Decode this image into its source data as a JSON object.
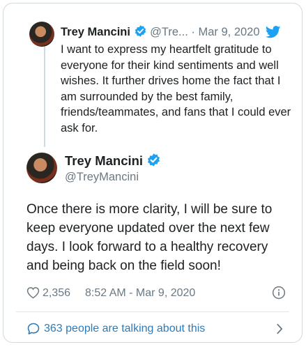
{
  "parent_tweet": {
    "author_name": "Trey Mancini",
    "handle": "@Tre...",
    "separator": "·",
    "date": "Mar 9, 2020",
    "text": "I want to express my heartfelt gratitude to everyone for their kind sentiments and well wishes. It further drives home the fact that I am surrounded by the best family, friends/teammates, and fans that I could ever ask for."
  },
  "main_tweet": {
    "author_name": "Trey Mancini",
    "handle": "@TreyMancini",
    "text": "Once there is more clarity, I will be sure to keep everyone updated over the next few days. I look forward to a healthy recovery and being back on the field soon!",
    "like_count": "2,356",
    "timestamp": "8:52 AM - Mar 9, 2020"
  },
  "footer": {
    "talking_label": "363 people are talking about this"
  },
  "icons": {
    "verified": "verified-badge-icon",
    "bird": "twitter-bird-icon",
    "like": "heart-outline-icon",
    "info": "info-circle-icon",
    "talk": "speech-bubble-icon",
    "chevron": "chevron-right-icon"
  },
  "colors": {
    "verified_blue": "#1da1f2",
    "link_blue": "#2b7bb9",
    "muted_gray": "#697882"
  }
}
